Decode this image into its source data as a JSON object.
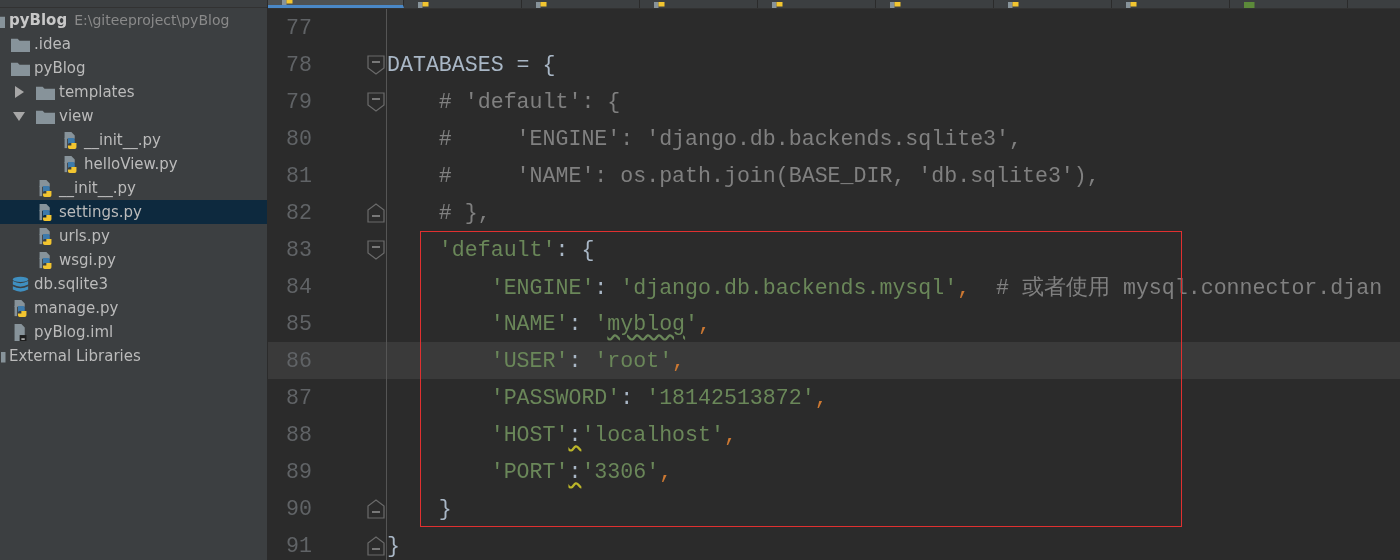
{
  "tabs": [
    {
      "kind": "python",
      "selected": true
    },
    {
      "kind": "python",
      "selected": false
    },
    {
      "kind": "python",
      "selected": false
    },
    {
      "kind": "python",
      "selected": false
    },
    {
      "kind": "python",
      "selected": false
    },
    {
      "kind": "python",
      "selected": false
    },
    {
      "kind": "python",
      "selected": false
    },
    {
      "kind": "python",
      "selected": false
    },
    {
      "kind": "html",
      "selected": false
    }
  ],
  "project_tree": [
    {
      "label": "pyBlog",
      "path": "E:\\giteeproject\\pyBlog",
      "kind": "project",
      "selected": false,
      "children": [
        {
          "label": ".idea",
          "kind": "folder",
          "selected": false
        },
        {
          "label": "pyBlog",
          "kind": "folder",
          "selected": false,
          "children": [
            {
              "label": "templates",
              "kind": "folder",
              "expanded": false,
              "selected": false
            },
            {
              "label": "view",
              "kind": "folder",
              "expanded": true,
              "selected": false,
              "children": [
                {
                  "label": "__init__.py",
                  "kind": "python",
                  "selected": false
                },
                {
                  "label": "helloView.py",
                  "kind": "python",
                  "selected": false
                }
              ]
            },
            {
              "label": "__init__.py",
              "kind": "python",
              "selected": false
            },
            {
              "label": "settings.py",
              "kind": "python",
              "selected": true
            },
            {
              "label": "urls.py",
              "kind": "python",
              "selected": false
            },
            {
              "label": "wsgi.py",
              "kind": "python",
              "selected": false
            }
          ]
        },
        {
          "label": "db.sqlite3",
          "kind": "database",
          "selected": false
        },
        {
          "label": "manage.py",
          "kind": "python",
          "selected": false
        },
        {
          "label": "pyBlog.iml",
          "kind": "iml",
          "selected": false
        }
      ]
    },
    {
      "label": "External Libraries",
      "kind": "library",
      "selected": false
    }
  ],
  "editor": {
    "blocks": [
      {
        "kind": "plain",
        "lines": [
          {
            "number": "77",
            "kind": "code",
            "current": false
          },
          {
            "number": "78",
            "kind": "fold-start",
            "current": false,
            "segments": [
              {
                "t": "DATABASES = {",
                "kind": "plain"
              }
            ]
          },
          {
            "number": "79",
            "kind": "fold-start",
            "current": false,
            "segments": [
              {
                "t": "    # 'default': {",
                "kind": "comment"
              }
            ]
          },
          {
            "number": "80",
            "kind": "code",
            "current": false,
            "segments": [
              {
                "t": "    #     'ENGINE': 'django.db.backends.sqlite3',",
                "kind": "comment"
              }
            ]
          },
          {
            "number": "81",
            "kind": "code",
            "current": false,
            "segments": [
              {
                "t": "    #     'NAME': os.path.join(BASE_DIR, 'db.sqlite3'),",
                "kind": "comment"
              }
            ]
          },
          {
            "number": "82",
            "kind": "fold-end",
            "current": false,
            "segments": [
              {
                "t": "    # },",
                "kind": "comment"
              }
            ]
          }
        ]
      },
      {
        "kind": "framed",
        "lines": [
          {
            "number": "83",
            "kind": "fold-start",
            "current": false,
            "segments": [
              {
                "t": "    'default'",
                "kind": "string"
              },
              {
                "t": ": {",
                "kind": "plain"
              }
            ]
          },
          {
            "number": "84",
            "kind": "code",
            "current": false,
            "segments": [
              {
                "t": "        'ENGINE'",
                "kind": "string"
              },
              {
                "t": ": ",
                "kind": "plain"
              },
              {
                "t": "'django.db.backends.mysql'",
                "kind": "string"
              },
              {
                "t": ",",
                "kind": "punct"
              },
              {
                "t": "  # 或者使用 mysql.connector.djan",
                "kind": "comment"
              }
            ]
          },
          {
            "number": "85",
            "kind": "code",
            "current": false,
            "segments": [
              {
                "t": "        'NAME'",
                "kind": "string"
              },
              {
                "t": ": ",
                "kind": "plain"
              },
              {
                "t": "'",
                "kind": "string"
              },
              {
                "t": "myblog",
                "kind": "typo"
              },
              {
                "t": "'",
                "kind": "string"
              },
              {
                "t": ",",
                "kind": "punct"
              }
            ]
          },
          {
            "number": "86",
            "kind": "code",
            "current": true,
            "segments": [
              {
                "t": "        'USER'",
                "kind": "string"
              },
              {
                "t": ": ",
                "kind": "plain"
              },
              {
                "t": "'root'",
                "kind": "string"
              },
              {
                "t": ",",
                "kind": "punct"
              }
            ]
          },
          {
            "number": "87",
            "kind": "code",
            "current": false,
            "segments": [
              {
                "t": "        'PASSWORD'",
                "kind": "string"
              },
              {
                "t": ": ",
                "kind": "plain"
              },
              {
                "t": "'18142513872'",
                "kind": "string"
              },
              {
                "t": ",",
                "kind": "punct"
              }
            ]
          },
          {
            "number": "88",
            "kind": "code",
            "current": false,
            "segments": [
              {
                "t": "        'HOST'",
                "kind": "string"
              },
              {
                "t": ":",
                "kind": "warn"
              },
              {
                "t": "'localhost'",
                "kind": "string"
              },
              {
                "t": ",",
                "kind": "punct"
              }
            ]
          },
          {
            "number": "89",
            "kind": "code",
            "current": false,
            "segments": [
              {
                "t": "        'PORT'",
                "kind": "string"
              },
              {
                "t": ":",
                "kind": "warn"
              },
              {
                "t": "'3306'",
                "kind": "string"
              },
              {
                "t": ",",
                "kind": "punct"
              }
            ]
          },
          {
            "number": "90",
            "kind": "fold-end",
            "current": false,
            "segments": [
              {
                "t": "    }",
                "kind": "plain"
              }
            ]
          }
        ]
      },
      {
        "kind": "plain",
        "lines": [
          {
            "number": "91",
            "kind": "fold-end",
            "current": false,
            "segments": [
              {
                "t": "}",
                "kind": "plain"
              }
            ]
          }
        ]
      }
    ]
  }
}
